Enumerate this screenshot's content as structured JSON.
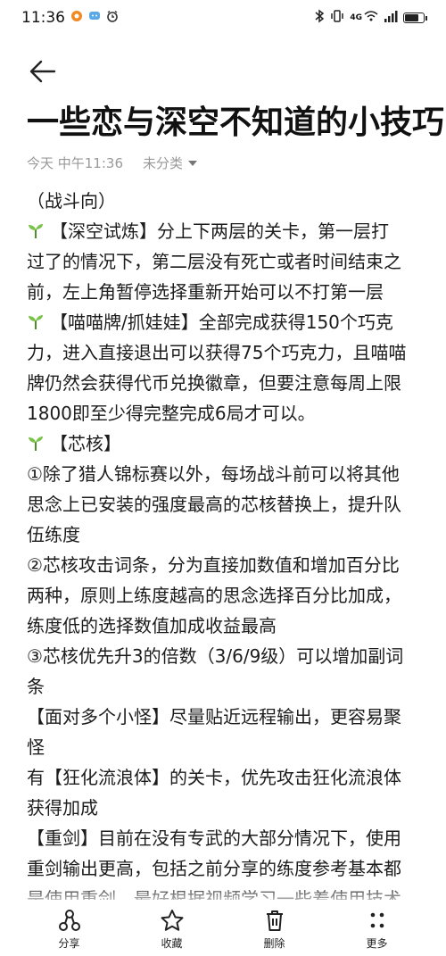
{
  "status_bar": {
    "time": "11:36",
    "notif_icons": [
      "shopping-icon",
      "chat-icon",
      "alarm-icon"
    ],
    "right_icons": [
      "bluetooth-icon",
      "vibrate-icon",
      "wifi-icon",
      "signal-icon"
    ],
    "signal_label": "4G",
    "battery_level": 0.85
  },
  "note": {
    "title": "一些恋与深空不知道的小技巧",
    "date": "今天 中午11:36",
    "category": "未分类",
    "lines": [
      {
        "text": "（战斗向）"
      },
      {
        "sprout": true,
        "text": "【深空试炼】分上下两层的关卡，第一层打"
      },
      {
        "text": "过了的情况下，第二层没有死亡或者时间结束之"
      },
      {
        "text": "前，左上角暂停选择重新开始可以不打第一层"
      },
      {
        "sprout": true,
        "text": "【喵喵牌/抓娃娃】全部完成获得150个巧克"
      },
      {
        "text": "力，进入直接退出可以获得75个巧克力，且喵喵"
      },
      {
        "text": "牌仍然会获得代币兑换徽章，但要注意每周上限"
      },
      {
        "text": "1800即至少得完整完成6局才可以。"
      },
      {
        "sprout": true,
        "text": "【芯核】"
      },
      {
        "text": "①除了猎人锦标赛以外，每场战斗前可以将其他"
      },
      {
        "text": "思念上已安装的强度最高的芯核替换上，提升队"
      },
      {
        "text": "伍练度"
      },
      {
        "text": "②芯核攻击词条，分为直接加数值和增加百分比"
      },
      {
        "text": "两种，原则上练度越高的思念选择百分比加成，"
      },
      {
        "text": "练度低的选择数值加成收益最高"
      },
      {
        "text": "③芯核优先升3的倍数（3/6/9级）可以增加副词"
      },
      {
        "text": "条"
      },
      {
        "text": "【面对多个小怪】尽量贴近远程输出，更容易聚"
      },
      {
        "text": "怪"
      },
      {
        "text": "有【狂化流浪体】的关卡，优先攻击狂化流浪体"
      },
      {
        "text": "获得加成"
      },
      {
        "text": "【重剑】目前在没有专武的大部分情况下，使用"
      },
      {
        "text": "重剑输出更高，包括之前分享的练度参考基本都"
      },
      {
        "text": "是使用重剑，最好根据视频学习一些着使用技术"
      }
    ]
  },
  "bottom_bar": {
    "share": "分享",
    "favorite": "收藏",
    "delete": "删除",
    "more": "更多"
  },
  "colors": {
    "text": "#1c1c1c",
    "meta": "#999999",
    "sprout_leaf": "#7cc24a",
    "sprout_stem": "#4f8f2a"
  }
}
